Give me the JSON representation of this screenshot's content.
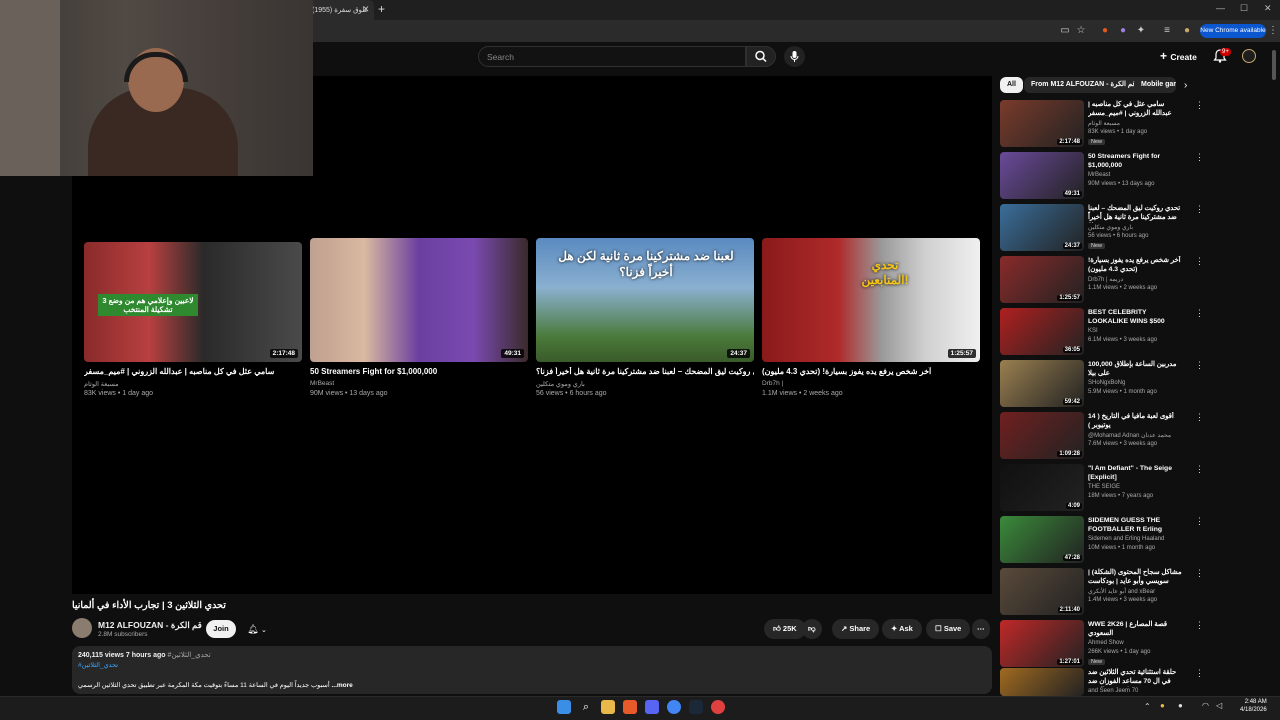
{
  "browser": {
    "tab_title": "(1955) غلوق سفرة",
    "new_chrome": "New Chrome available"
  },
  "header": {
    "search_placeholder": "Search",
    "create_label": "Create",
    "notif_count": "9+"
  },
  "endscreen": [
    {
      "title": "سامي عثل في كل مناصبه | عبدالله الزروني | #ميم_مسفر",
      "channel": "مسبعة الوثام",
      "meta": "83K views • 1 day ago",
      "duration": "2:17:48",
      "overlay": "3 لاعبين وإعلامي هم من وضع تشكيلة المنتخب"
    },
    {
      "title": "50 Streamers Fight for $1,000,000",
      "channel": "MrBeast",
      "meta": "90M views • 13 days ago",
      "duration": "49:31"
    },
    {
      "title": "تحدي روكيت ليق المضحك – لعبنا ضد مشتركينا مرة ثانية هل أخيراً فزنا؟",
      "channel": "باري وموي متكلين",
      "meta": "56 views • 6 hours ago",
      "duration": "24:37",
      "overlay": "لعبنا ضد مشتركينا مرة ثانية لكن هل أخيراً فزنا؟"
    },
    {
      "title": "آخر شخص يرفع يده يفوز بسيارة! (تحدي 4.3 مليون)",
      "channel": "Drb7h |",
      "meta": "1.1M views • 2 weeks ago",
      "duration": "1:25:57",
      "overlay": "تحدي المتابعين!"
    }
  ],
  "video": {
    "title": "تحدي الثلاثين 3 | تجارب الأداء في ألمانيا",
    "channel": "M12 ALFOUZAN - قم الكرة",
    "subscribers": "2.8M subscribers",
    "join": "Join",
    "likes": "25K",
    "share": "Share",
    "ask": "Ask",
    "save": "Save",
    "views": "240,115 views",
    "time": "7 hours ago",
    "hashtags_1": "#تحدي_الثلاثين",
    "hashtags_2": "#تحدي_الثلاثين",
    "desc": "أسبوب جديداً اليوم في الساعة 11 مساءً بتوقيت مكة المكرمة عبر تطبيق تحدي الثلاثين الرسمي",
    "more": "...more"
  },
  "chips": [
    "All",
    "From M12 ALFOUZAN - قم الكرة",
    "Mobile games"
  ],
  "recommendations": [
    {
      "title": "سامي عثل في كل مناصبه | عبدالله الزروني | #ميم_مسفر",
      "channel": "مسبعة الوثام",
      "meta": "83K views • 1 day ago",
      "duration": "2:17:48",
      "new": "New",
      "color": "#7a3b2b"
    },
    {
      "title": "50 Streamers Fight for $1,000,000",
      "channel": "MrBeast",
      "meta": "90M views • 13 days ago",
      "duration": "49:31",
      "color": "#6a4a9a"
    },
    {
      "title": "تحدي روكيت ليق المضحك – لعبنا ضد مشتركينا مرة ثانية هل أخيراً فزنا؟",
      "channel": "باري وموي متكلين",
      "meta": "56 views • 6 hours ago",
      "duration": "24:37",
      "new": "New",
      "color": "#3a6e9a"
    },
    {
      "title": "آخر شخص يرفع يده يفوز بسيارة! (تحدي 4.3 مليون)",
      "channel": "Drb7h | دريمه",
      "meta": "1.1M views • 2 weeks ago",
      "duration": "1:25:57",
      "color": "#8a2a2a"
    },
    {
      "title": "BEST CELEBRITY LOOKALIKE WINS $500",
      "channel": "KSI",
      "meta": "6.1M views • 3 weeks ago",
      "duration": "36:05",
      "color": "#b02020"
    },
    {
      "title": "100,000 مدربين الساعة بإطلاق على بيلا",
      "channel": "SHoNgxBoNg",
      "meta": "5.9M views • 1 month ago",
      "duration": "59:42",
      "color": "#9a8050"
    },
    {
      "title": "أقوى لعبة مافيا في التاريخ ( 14 يوتيوبر )",
      "channel": "@Mohamad Adnan محمد عدنان",
      "meta": "7.6M views • 3 weeks ago",
      "duration": "1:09:28",
      "color": "#702020"
    },
    {
      "title": "\"I Am Defiant\" - The Seige [Explicit]",
      "channel": "THE SEIGE",
      "meta": "18M views • 7 years ago",
      "duration": "4:09",
      "color": "#101010"
    },
    {
      "title": "SIDEMEN GUESS THE FOOTBALLER ft Erling Haaland",
      "channel": "Sidemen and Erling Haaland",
      "meta": "10M views • 1 month ago",
      "duration": "47:28",
      "color": "#3a8a3a"
    },
    {
      "title": "مشاكل سجاح المحتوى (الشكلة) | سويسي وأبو عايد | بودكاست بسري عمر",
      "channel": "أبو عايد الأبكري and xBear",
      "meta": "1.4M views • 3 weeks ago",
      "duration": "2:11:40",
      "color": "#5a4a3a"
    },
    {
      "title": "WWE 2K26 | قصة المصارع السعودي",
      "channel": "Ahmed Show",
      "meta": "266K views • 1 day ago",
      "duration": "1:27:01",
      "new": "New",
      "color": "#c02828"
    },
    {
      "title": "حلقة استثنائية تحدي الثلاثين ضد في ال 70 مساعد الفوزان ضد دكتور عبدالعزيز | ...",
      "channel": "and Seen Jeem 70",
      "meta": "",
      "duration": "",
      "color": "#a06a20"
    }
  ],
  "clock": {
    "time": "2:48 AM",
    "date": "4/18/2026"
  }
}
